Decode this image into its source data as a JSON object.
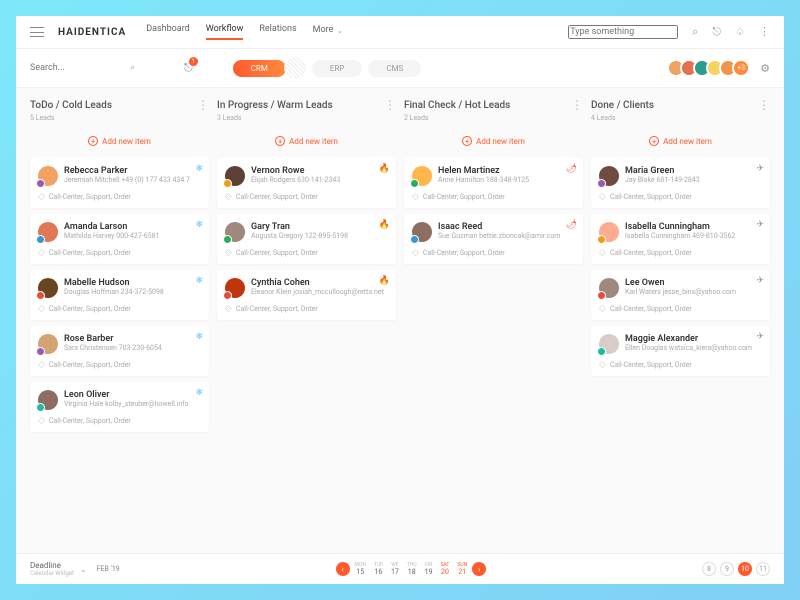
{
  "logo": "HAIDENTICA",
  "nav": {
    "dashboard": "Dashboard",
    "workflow": "Workflow",
    "relations": "Relations",
    "more": "More"
  },
  "searchTopPlaceholder": "Type something",
  "searchBoxPlaceholder": "Search...",
  "cartBadge": "1",
  "pills": {
    "crm": "CRM",
    "erp": "ERP",
    "cms": "CMS"
  },
  "avatarsMore": "+3",
  "columns": [
    {
      "title": "ToDo / Cold Leads",
      "sub": "5 Leads",
      "add": "Add new item",
      "iconColor": "#5ac8fa",
      "icon": "❄",
      "cards": [
        {
          "name": "Rebecca Parker",
          "meta": "Jeremiah Mitchell   +49 (0) 177 433 434 7",
          "av": "#f4a261",
          "dot": "#9b59b6"
        },
        {
          "name": "Amanda Larson",
          "meta": "Mathilda Harvey   000-427-6581",
          "av": "#e07856",
          "dot": "#3498db"
        },
        {
          "name": "Mabelle Hudson",
          "meta": "Douglas Hoffman   234-372-5098",
          "av": "#6b4423",
          "dot": "#e74c3c"
        },
        {
          "name": "Rose Barber",
          "meta": "Sara Christensen   703-230-6054",
          "av": "#d4a373",
          "dot": "#9b59b6"
        },
        {
          "name": "Leon Oliver",
          "meta": "Virginia Hale   kolby_steuber@howell.info",
          "av": "#8d6e63",
          "dot": "#1abc9c"
        }
      ]
    },
    {
      "title": "In Progress / Warm Leads",
      "sub": "3 Leads",
      "add": "Add new item",
      "iconColor": "#ff8a3c",
      "icon": "🔥",
      "cards": [
        {
          "name": "Vernon Rowe",
          "meta": "Elijah Rodgers   630-141-2343",
          "av": "#5d4037",
          "dot": "#f39c12"
        },
        {
          "name": "Gary Tran",
          "meta": "Augusta Gregory   122-895-5198",
          "av": "#a1887f",
          "dot": "#27ae60"
        },
        {
          "name": "Cynthia Cohen",
          "meta": "Eleanor Klein   josiah_mccullough@retta.net",
          "av": "#bf360c",
          "dot": "#e74c3c"
        }
      ]
    },
    {
      "title": "Final Check / Hot Leads",
      "sub": "2 Leads",
      "add": "Add new item",
      "iconColor": "#e74c3c",
      "icon": "🌶",
      "cards": [
        {
          "name": "Helen Martinez",
          "meta": "Anne Hamilton   188-348-9125",
          "av": "#ffb74d",
          "dot": "#27ae60"
        },
        {
          "name": "Isaac Reed",
          "meta": "Sue Guzman   bettie.zboncak@amir.com",
          "av": "#8d6e63",
          "dot": "#3498db"
        }
      ]
    },
    {
      "title": "Done / Clients",
      "sub": "4 Leads",
      "add": "Add new item",
      "iconColor": "#999",
      "icon": "✈",
      "cards": [
        {
          "name": "Maria Green",
          "meta": "Jay Blake   681-149-2843",
          "av": "#6d4c41",
          "dot": "#9b59b6"
        },
        {
          "name": "Isabella Cunningham",
          "meta": "Isabella Cunningham   469-810-3562",
          "av": "#ffab91",
          "dot": "#f39c12"
        },
        {
          "name": "Lee Owen",
          "meta": "Karl Waters   jesse_bins@yahoo.com",
          "av": "#a1887f",
          "dot": "#e74c3c"
        },
        {
          "name": "Maggie Alexander",
          "meta": "Ellen Douglas   watsica_kiera@yahoo.com",
          "av": "#d7ccc8",
          "dot": "#1abc9c"
        }
      ]
    }
  ],
  "tags": "Call-Center,  Support,  Order",
  "footer": {
    "deadline": "Deadline",
    "sub": "Calendar Widget",
    "month": "FEB '19",
    "days": [
      {
        "l": "MON",
        "n": "15"
      },
      {
        "l": "TUE",
        "n": "16"
      },
      {
        "l": "WE",
        "n": "17"
      },
      {
        "l": "THU",
        "n": "18"
      },
      {
        "l": "FRI",
        "n": "19"
      },
      {
        "l": "SAT",
        "n": "20",
        "w": true
      },
      {
        "l": "SUN",
        "n": "21",
        "w": true
      }
    ],
    "pages": [
      "8",
      "9",
      "10",
      "11"
    ]
  }
}
